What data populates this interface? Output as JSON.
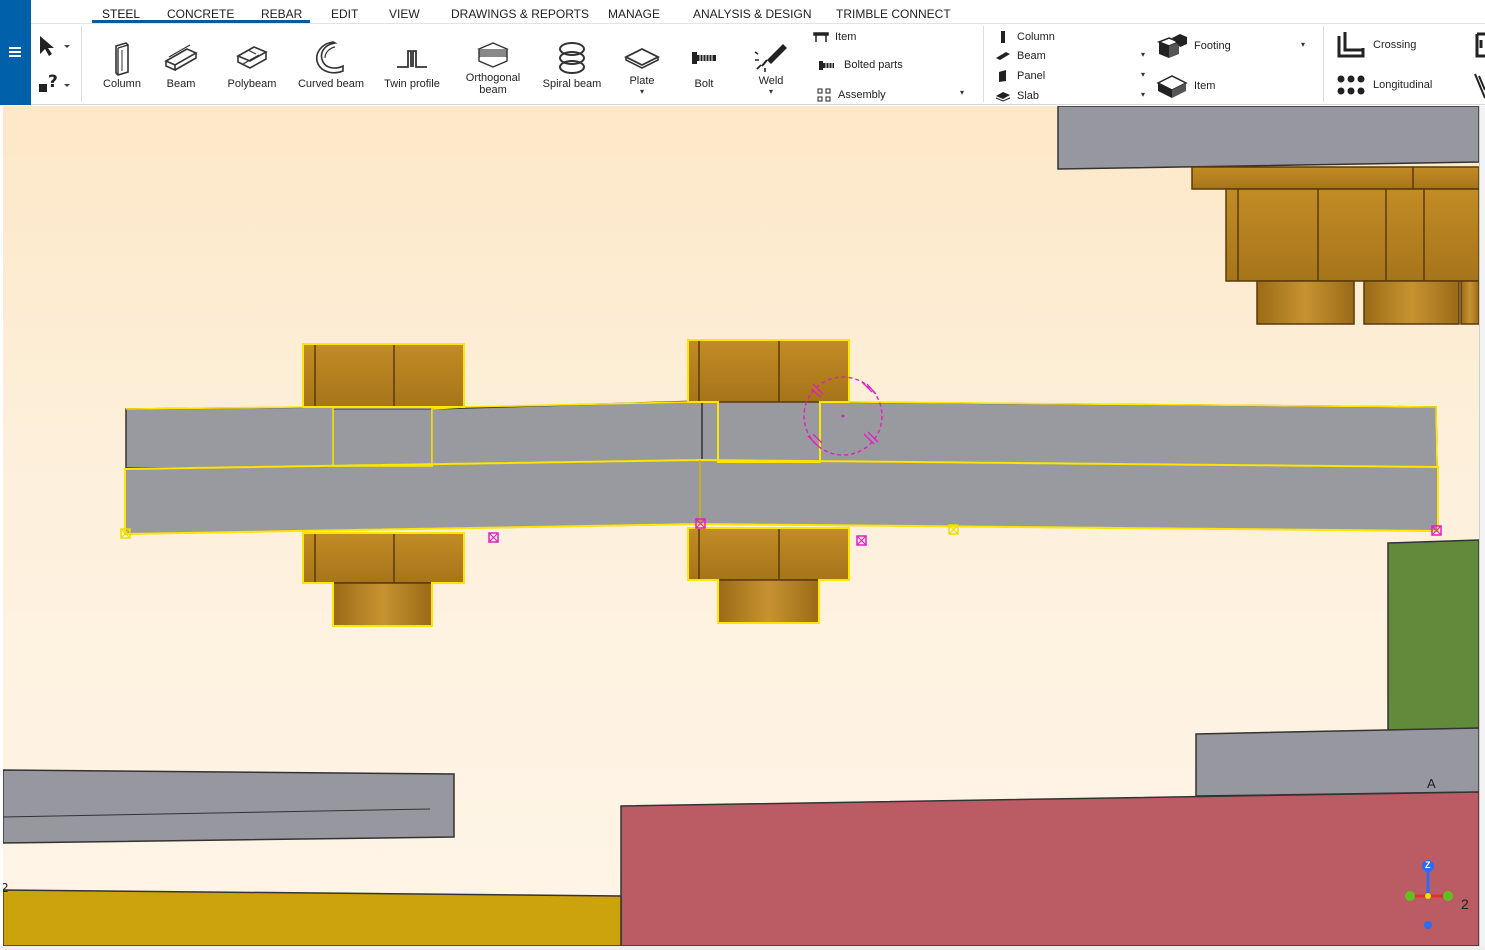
{
  "tabs": [
    {
      "label": "STEEL"
    },
    {
      "label": "CONCRETE"
    },
    {
      "label": "REBAR"
    },
    {
      "label": "EDIT"
    },
    {
      "label": "VIEW"
    },
    {
      "label": "DRAWINGS & REPORTS"
    },
    {
      "label": "MANAGE"
    },
    {
      "label": "ANALYSIS & DESIGN"
    },
    {
      "label": "TRIMBLE CONNECT"
    }
  ],
  "active_tab": "STEEL",
  "ribbon": {
    "buttons": [
      {
        "label": "Column",
        "icon": "column-icon"
      },
      {
        "label": "Beam",
        "icon": "beam-icon"
      },
      {
        "label": "Polybeam",
        "icon": "polybeam-icon"
      },
      {
        "label": "Curved beam",
        "icon": "curved-beam-icon"
      },
      {
        "label": "Twin profile",
        "icon": "twin-profile-icon"
      },
      {
        "label": "Orthogonal beam",
        "icon": "orthogonal-beam-icon"
      },
      {
        "label": "Spiral beam",
        "icon": "spiral-beam-icon"
      },
      {
        "label": "Plate",
        "icon": "plate-icon"
      },
      {
        "label": "Bolt",
        "icon": "bolt-icon"
      },
      {
        "label": "Weld",
        "icon": "weld-icon"
      }
    ],
    "component_group": [
      {
        "label": "Item",
        "icon": "item-icon"
      },
      {
        "label": "Bolted parts",
        "icon": "bolted-parts-icon"
      },
      {
        "label": "Assembly",
        "icon": "assembly-icon"
      }
    ],
    "concrete_group": [
      {
        "label": "Column",
        "icon": "concrete-column-icon"
      },
      {
        "label": "Beam",
        "icon": "concrete-beam-icon"
      },
      {
        "label": "Panel",
        "icon": "panel-icon"
      },
      {
        "label": "Slab",
        "icon": "slab-icon"
      }
    ],
    "footing_group": [
      {
        "label": "Footing",
        "icon": "footing-icon"
      },
      {
        "label": "Item",
        "icon": "concrete-item-icon"
      }
    ],
    "rebar_group": [
      {
        "label": "Crossing",
        "icon": "crossing-icon"
      },
      {
        "label": "Longitudinal",
        "icon": "longitudinal-icon"
      }
    ]
  },
  "viewport": {
    "grid_label": "A",
    "side_label": "2",
    "axis_label": "2",
    "axis_z_label": "Z"
  },
  "colors": {
    "brand_blue": "#0060aa",
    "steel_grey": "#999aa0",
    "timber_brown": "#b5811f",
    "selection_yellow": "#ffe600",
    "handle_magenta": "#e020c0",
    "concrete_red": "#bb5c64",
    "footing_green": "#618b3b",
    "ground_yellow": "#cda30d"
  }
}
